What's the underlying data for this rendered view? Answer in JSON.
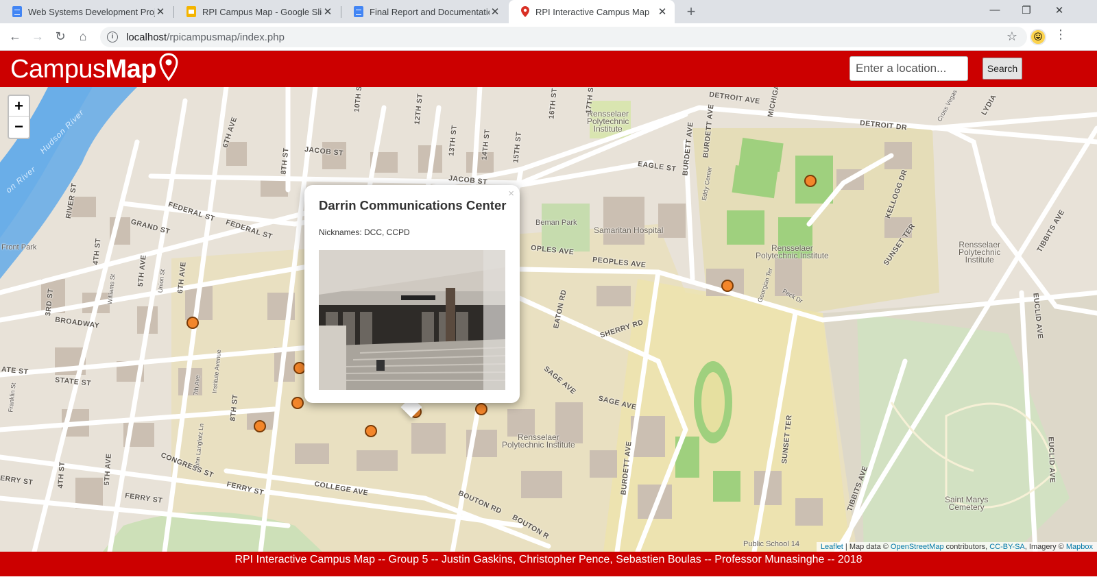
{
  "browser": {
    "tabs": [
      {
        "title": "Web Systems Development Proje",
        "favicon": "google-docs-icon"
      },
      {
        "title": "RPI Campus Map - Google Slides",
        "favicon": "google-slides-icon"
      },
      {
        "title": "Final Report and Documentation",
        "favicon": "google-docs-icon"
      },
      {
        "title": "RPI Interactive Campus Map",
        "favicon": "map-pin-icon",
        "active": true
      }
    ],
    "url_host": "localhost",
    "url_path": "/rpicampusmap/index.php"
  },
  "header": {
    "logo_part1": "Campus",
    "logo_part2": "Map",
    "search_placeholder": "Enter a location...",
    "search_button": "Search",
    "color": "#cc0000"
  },
  "map": {
    "zoom_in": "+",
    "zoom_out": "−",
    "river_labels": [
      "Hudson River",
      "on River"
    ],
    "place_labels": {
      "rpi_north": "Rensselaer\nPolytechnic\nInstitute",
      "rpi_east": "Rensselaer\nPolytechnic Institute",
      "rpi_far_east": "Rensselaer\nPolytechnic\nInstitute",
      "rpi_south": "Rensselaer\nPolytechnic Institute",
      "beman_park": "Beman Park",
      "samaritan": "Samaritan Hospital",
      "saint_marys": "Saint Marys\nCemetery",
      "public_school": "Public School 14",
      "front_park": "Front Park"
    },
    "street_labels": {
      "detroit_ave": "DETROIT AVE",
      "detroit_dr": "DETROIT DR",
      "jacob_st": "JACOB ST",
      "jacob_st2": "JACOB ST",
      "eagle_st": "EAGLE ST",
      "federal_st": "FEDERAL ST",
      "federal_st2": "FEDERAL ST",
      "grand_st": "GRAND ST",
      "peoples_ave": "PEOPLES AVE",
      "peoples_ave2": "OPLES AVE",
      "broadway": "BROADWAY",
      "state_st": "STATE ST",
      "ate_st": "ATE ST",
      "congress_st": "CONGRESS ST",
      "ferry_st": "FERRY ST",
      "ferry_st2": "FERRY ST",
      "ferry_st3": "ERRY ST",
      "college_ave": "COLLEGE AVE",
      "bouton_rd": "BOUTON RD",
      "bouton_rd2": "BOUTON R",
      "sage_ave": "SAGE AVE",
      "sage_ave2": "SAGE AVE",
      "sherry_rd": "SHERRY RD",
      "eaton_rd": "EATON RD",
      "sunset_ter": "SUNSET TER",
      "sunset_ter2": "SUNSET TER",
      "kellogg_dr": "KELLOGG DR",
      "tibbits_ave": "TIBBITS AVE",
      "tibbits_ave2": "TIBBITS AVE",
      "euclid_ave": "EUCLID AVE",
      "euclid_ave2": "EUCLID AVE",
      "burdett_ave": "BURDETT AVE",
      "burdett_ave2": "BURDETT AVE",
      "burdett_ave3": "BURDETT AVE",
      "sixth_ave": "6TH AVE",
      "sixth_ave2": "6TH AVE",
      "fifth_ave": "5TH AVE",
      "fifth_ave2": "5TH AVE",
      "fourth_st": "4TH ST",
      "fourth_st2": "4TH ST",
      "third_st": "3RD ST",
      "eighth_st": "8TH ST",
      "eighth_st2": "8TH ST",
      "river_st": "RIVER ST",
      "lydia": "LYDIA",
      "michigan": "MICHIGA",
      "peck_dr": "Peck Dr",
      "georgian_ter": "Georgian Ter",
      "cross_vegas": "Cross Vegas",
      "eddy_center": "Eddy Center",
      "union_st": "Union St",
      "williams_st": "Williams St",
      "institute_ave": "Institute Avenue",
      "seventh_ave_small": "7th Ave",
      "john_langlotz": "John Langlotz Ln",
      "franklin_st": "Franklin St",
      "tenth_st": "10TH ST",
      "twelfth_st": "12TH ST",
      "thirteenth_st": "13TH ST",
      "fourteenth_st": "14TH ST",
      "fifteenth_st": "15TH ST",
      "sixteenth_st": "16TH ST",
      "seventeenth_st": "17TH ST"
    },
    "attribution": {
      "leaflet": "Leaflet",
      "text1": " | Map data © ",
      "osm": "OpenStreetMap",
      "text2": " contributors, ",
      "ccbysa": "CC-BY-SA",
      "text3": ", Imagery © ",
      "mapbox": "Mapbox"
    },
    "popup": {
      "title": "Darrin Communications Center",
      "nicknames": "Nicknames: DCC, CCPD",
      "close": "×"
    },
    "marker_color": "#f3862b"
  },
  "footer": {
    "text": "RPI Interactive Campus Map -- Group 5 -- Justin Gaskins, Christopher Pence, Sebastien Boulas -- Professor Munasinghe -- 2018"
  }
}
